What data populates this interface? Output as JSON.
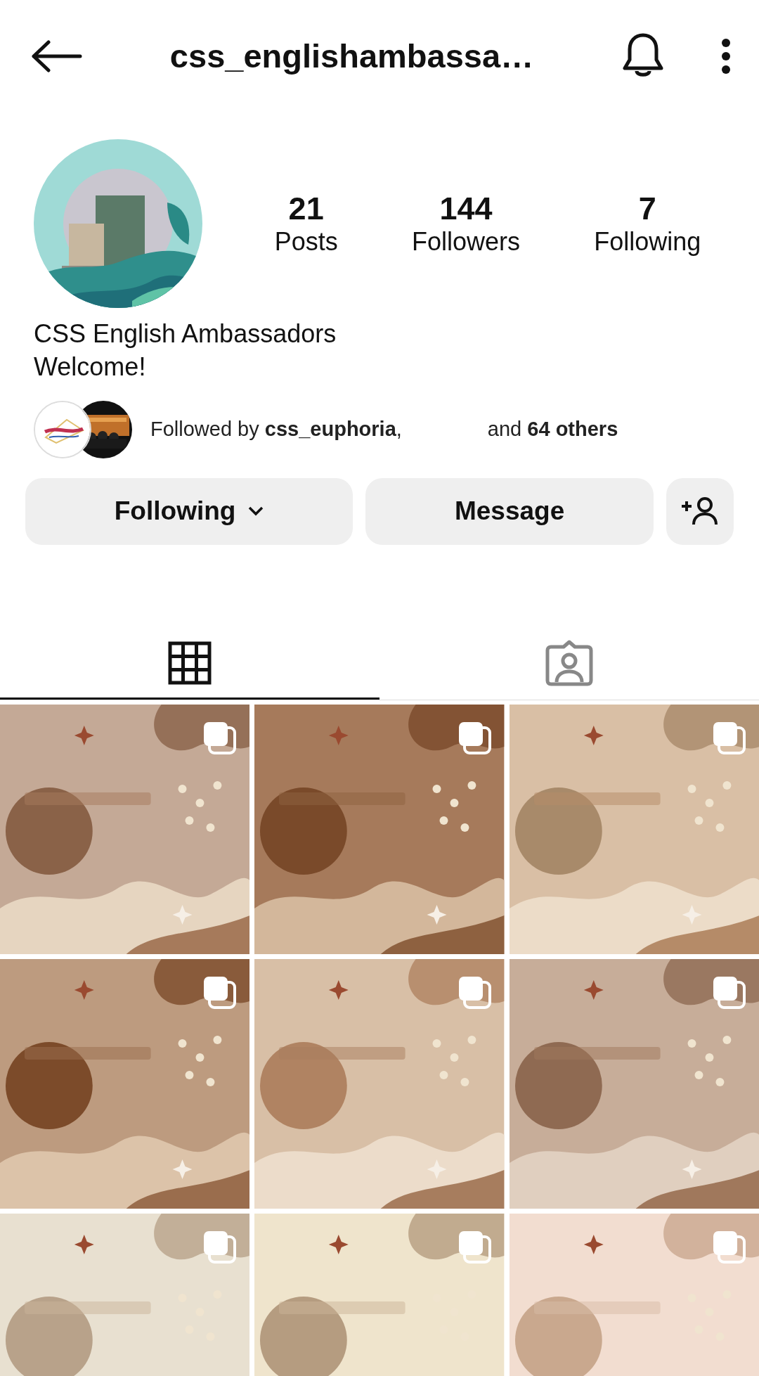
{
  "header": {
    "title": "css_englishambassa…"
  },
  "profile": {
    "stats": [
      {
        "value": "21",
        "label": "Posts"
      },
      {
        "value": "144",
        "label": "Followers"
      },
      {
        "value": "7",
        "label": "Following"
      }
    ],
    "name": "CSS English Ambassadors",
    "bio": "Welcome!"
  },
  "followed_by": {
    "text_before": "Followed by **css_euphoria**,",
    "text_after": "and **64 others**"
  },
  "buttons": [
    {
      "kind": "dropdown",
      "label": "Following"
    },
    {
      "kind": "text",
      "label": "Message"
    },
    {
      "kind": "add-person"
    }
  ],
  "tabs": [
    {
      "kind": "grid",
      "selected": true
    },
    {
      "kind": "tagged",
      "selected": false
    }
  ],
  "posts": [
    {
      "kind": "picture",
      "multiple": true
    },
    {
      "kind": "picture",
      "multiple": true
    },
    {
      "kind": "picture",
      "multiple": true
    },
    {
      "kind": "picture",
      "multiple": true
    },
    {
      "kind": "picture",
      "multiple": true
    },
    {
      "kind": "picture",
      "multiple": true
    },
    {
      "kind": "picture",
      "multiple": true
    },
    {
      "kind": "picture",
      "multiple": true
    },
    {
      "kind": "picture",
      "multiple": true
    }
  ]
}
